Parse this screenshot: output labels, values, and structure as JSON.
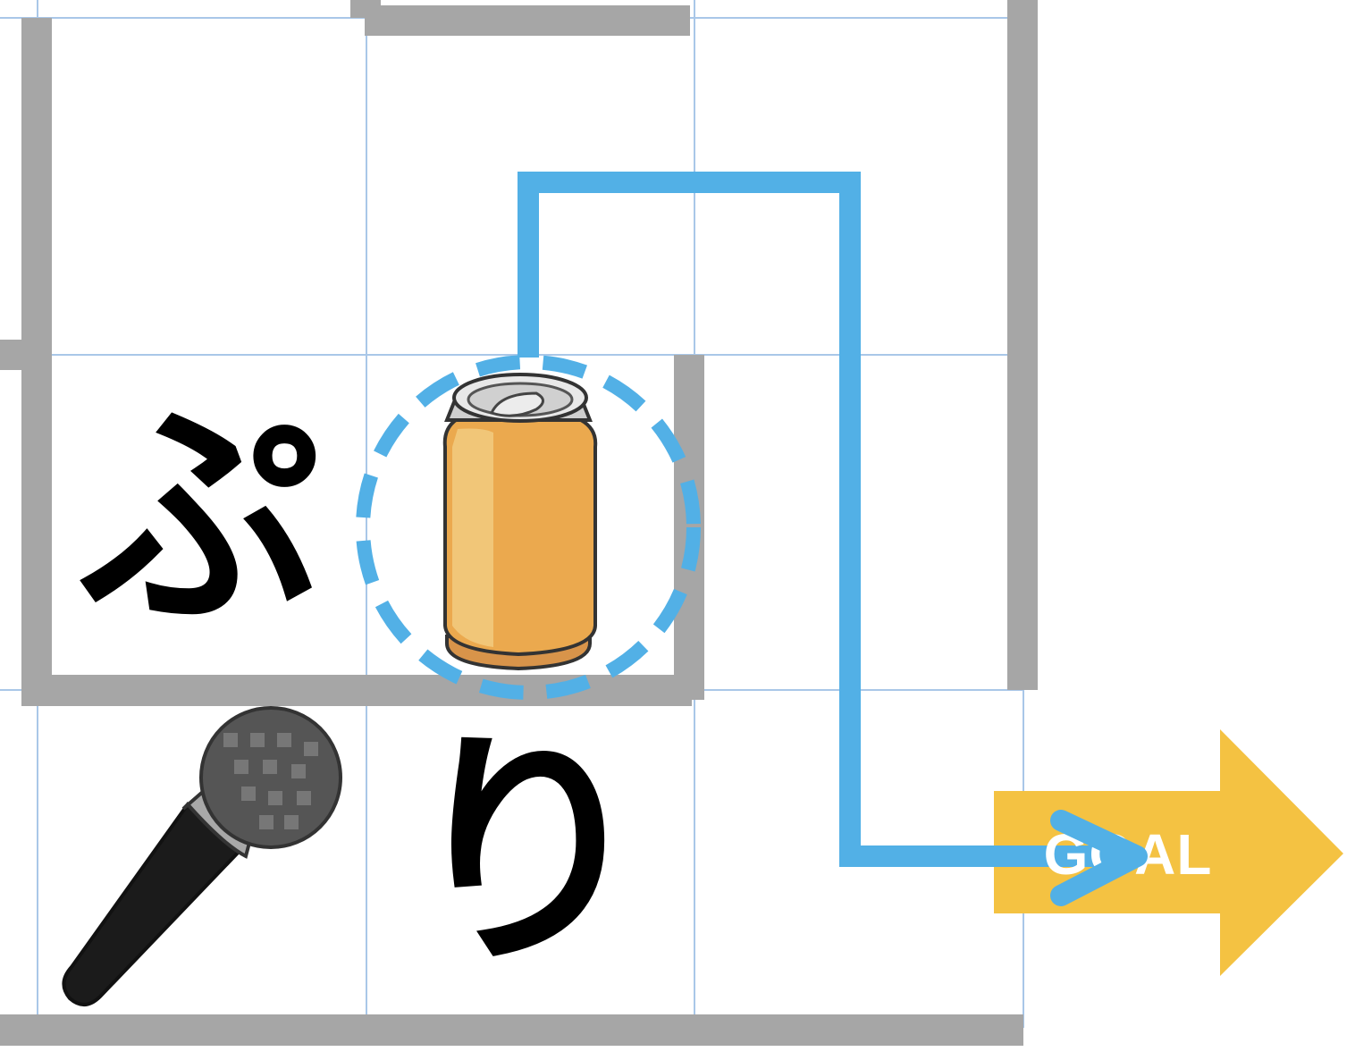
{
  "puzzle": {
    "cells": {
      "pu_char": "ぷ",
      "ri_char": "り"
    },
    "items": {
      "can": "can-icon",
      "microphone": "microphone-icon"
    },
    "goal": {
      "label": "GOAL",
      "color": "#f4c242"
    },
    "colors": {
      "path": "#52b0e6",
      "wall": "#a6a6a6",
      "grid": "#a9c7e8",
      "can_body": "#eba94e",
      "mic_head": "#555555",
      "mic_handle": "#1b1b1b"
    }
  }
}
